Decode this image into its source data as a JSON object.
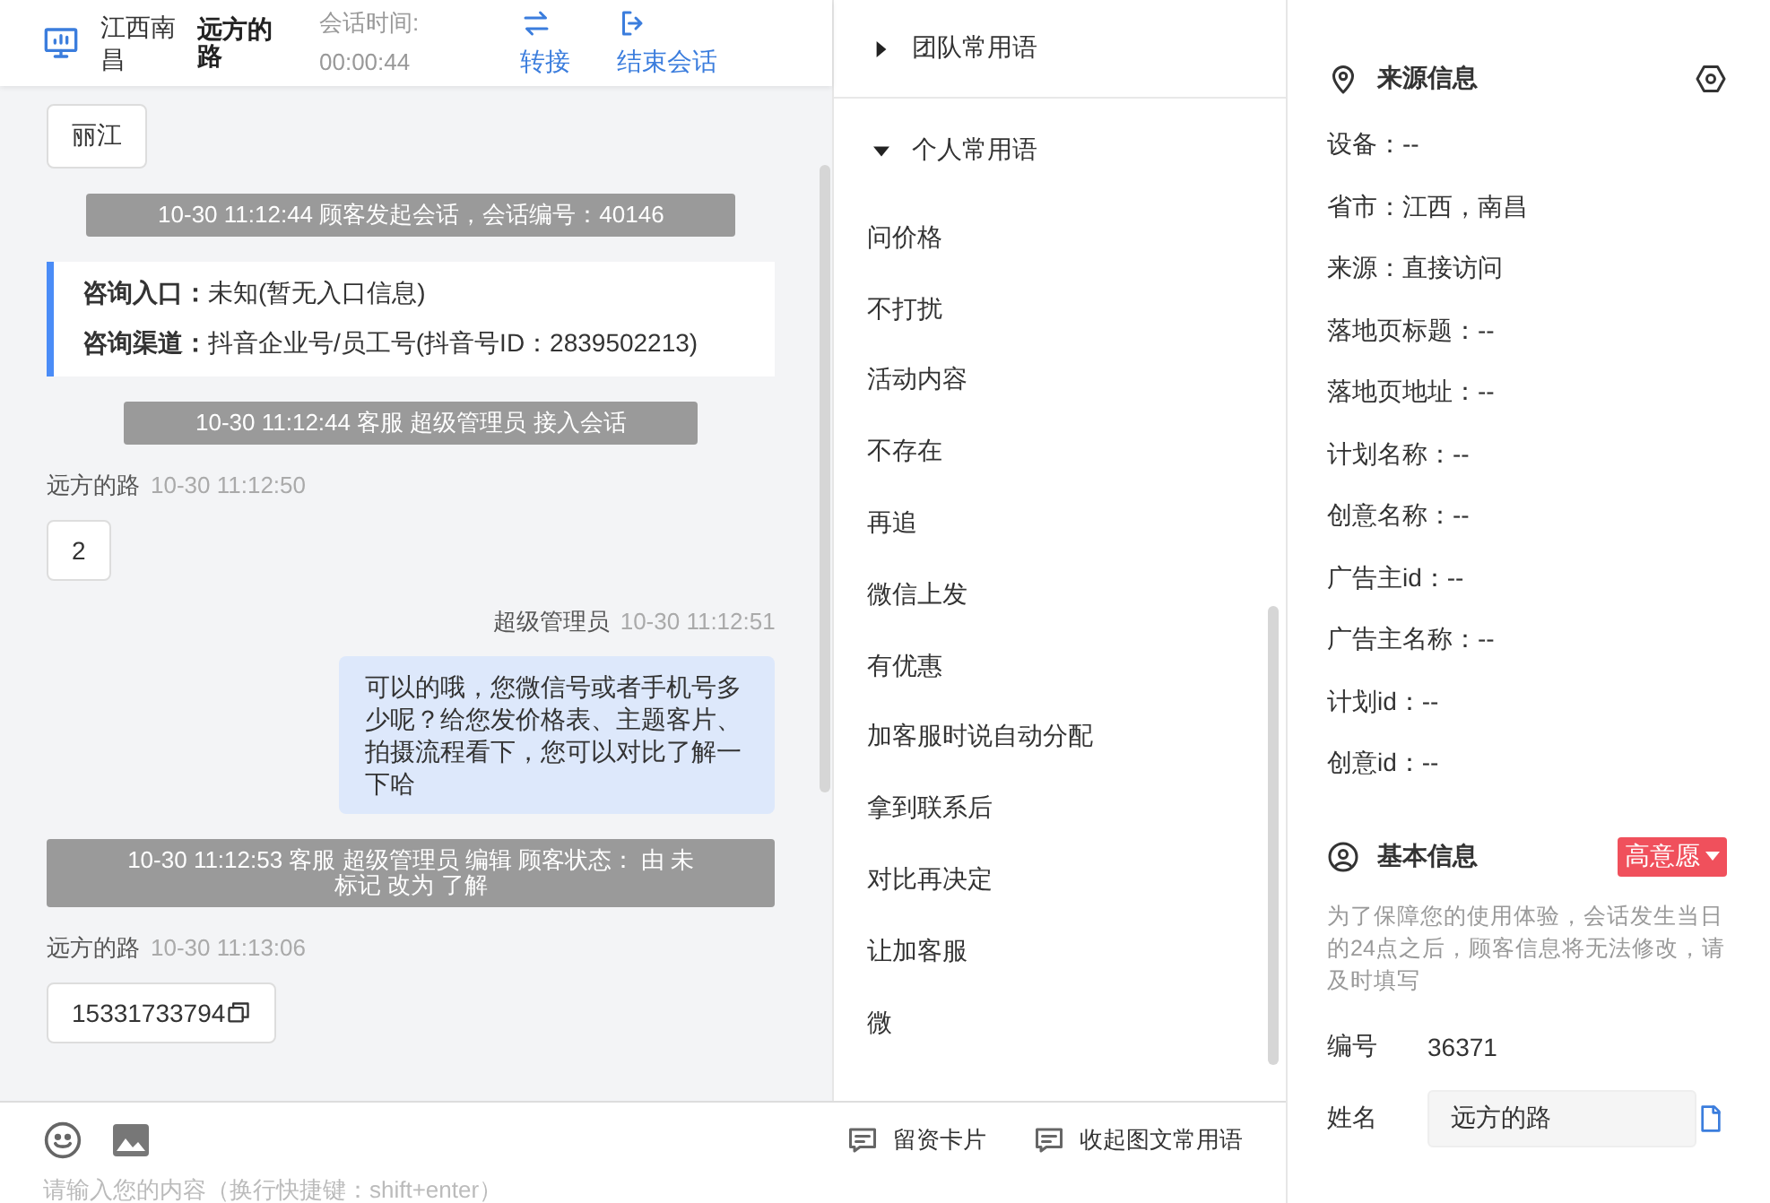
{
  "chat_header": {
    "location": "江西南昌",
    "customer": "远方的路",
    "duration_label": "会话时间:",
    "duration": "00:00:44",
    "actions": [
      {
        "label": "转接",
        "kind": "transfer"
      },
      {
        "label": "结束会话",
        "kind": "end"
      }
    ]
  },
  "messages": [
    {
      "kind": "bubble",
      "text": "丽江"
    },
    {
      "kind": "system",
      "text": "10-30 11:12:44 顾客发起会话，会话编号：40146"
    },
    {
      "kind": "info_card",
      "rows": [
        {
          "label": "咨询入口：",
          "value": "未知(暂无入口信息)"
        },
        {
          "label": "咨询渠道：",
          "value": "抖音企业号/员工号(抖音号ID：2839502213)"
        }
      ]
    },
    {
      "kind": "system",
      "text": "10-30 11:12:44 客服 超级管理员 接入会话"
    },
    {
      "kind": "incoming",
      "sender": "远方的路",
      "time": "10-30 11:12:50",
      "text": "2",
      "copyable": false
    },
    {
      "kind": "outgoing",
      "sender": "超级管理员",
      "time": "10-30 11:12:51",
      "text": "可以的哦，您微信号或者手机号多少呢？给您发价格表、主题客片、拍摄流程看下，您可以对比了解一下哈"
    },
    {
      "kind": "system",
      "text": "10-30 11:12:53 客服 超级管理员 编辑 顾客状态： 由 未标记 改为 了解"
    },
    {
      "kind": "incoming",
      "sender": "远方的路",
      "time": "10-30 11:13:06",
      "text": "15331733794",
      "copyable": true
    }
  ],
  "phrases": {
    "groups": [
      {
        "title": "团队常用语",
        "expanded": false
      },
      {
        "title": "个人常用语",
        "expanded": true,
        "items": [
          "问价格",
          "不打扰",
          "活动内容",
          "不存在",
          "再追",
          "微信上发",
          "有优惠",
          "加客服时说自动分配",
          "拿到联系后",
          "对比再决定",
          "让加客服",
          "微"
        ]
      }
    ]
  },
  "composer": {
    "tools": [
      {
        "kind": "emoji"
      },
      {
        "kind": "image"
      }
    ],
    "buttons": [
      {
        "label": "留资卡片"
      },
      {
        "label": "收起图文常用语"
      }
    ],
    "placeholder": "请输入您的内容（换行快捷键：shift+enter）"
  },
  "source_info": {
    "title": "来源信息",
    "fields": [
      "设备：--",
      "省市：江西，南昌",
      "来源：直接访问",
      "落地页标题：--",
      "落地页地址：--",
      "计划名称：--",
      "创意名称：--",
      "广告主id：--",
      "广告主名称：--",
      "计划id：--",
      "创意id：--"
    ]
  },
  "basic_info": {
    "title": "基本信息",
    "intent_tag": "高意愿",
    "notice": "为了保障您的使用体验，会话发生当日的24点之后，顾客信息将无法修改，请及时填写",
    "fields": [
      {
        "kind": "text",
        "label": "编号",
        "value": "36371"
      },
      {
        "kind": "input",
        "label": "姓名",
        "value": "远方的路"
      }
    ]
  }
}
